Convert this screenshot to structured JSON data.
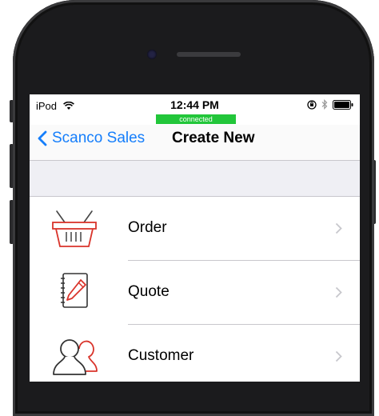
{
  "status_bar": {
    "carrier": "iPod",
    "time": "12:44 PM",
    "connection_badge": "connected"
  },
  "nav": {
    "back_label": "Scanco Sales",
    "title": "Create New"
  },
  "menu": {
    "items": [
      {
        "label": "Order",
        "icon": "shopping-basket-icon"
      },
      {
        "label": "Quote",
        "icon": "notepad-pencil-icon"
      },
      {
        "label": "Customer",
        "icon": "people-icon"
      }
    ]
  },
  "colors": {
    "accent": "#157efb",
    "connected": "#22c63a",
    "icon_red": "#d9342b",
    "separator": "#c8c7cc"
  }
}
